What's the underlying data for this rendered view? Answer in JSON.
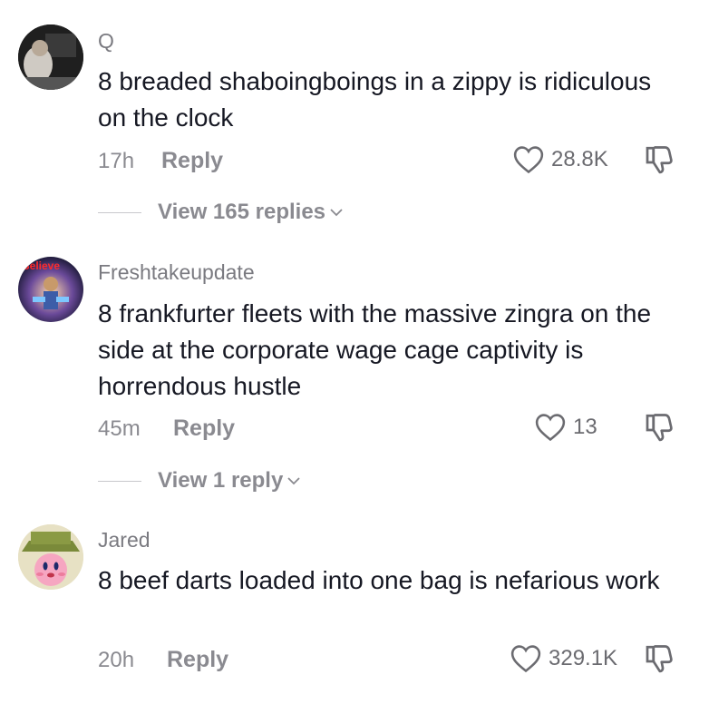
{
  "comments": [
    {
      "username": "Q",
      "text": "8 breaded shaboingboings in a zippy is ridiculous on the clock",
      "time": "17h",
      "reply_label": "Reply",
      "likes": "28.8K",
      "view_replies": "View 165 replies"
    },
    {
      "username": "Freshtakeupdate",
      "avatar_text": "Believe",
      "text": "8 frankfurter fleets with the massive zingra on the side at the corporate wage cage captivity is horrendous hustle",
      "time": "45m",
      "reply_label": "Reply",
      "likes": "13",
      "view_replies": "View 1 reply"
    },
    {
      "username": "Jared",
      "text": "8 beef darts loaded into one bag is nefarious work",
      "time": "20h",
      "reply_label": "Reply",
      "likes": "329.1K"
    }
  ]
}
